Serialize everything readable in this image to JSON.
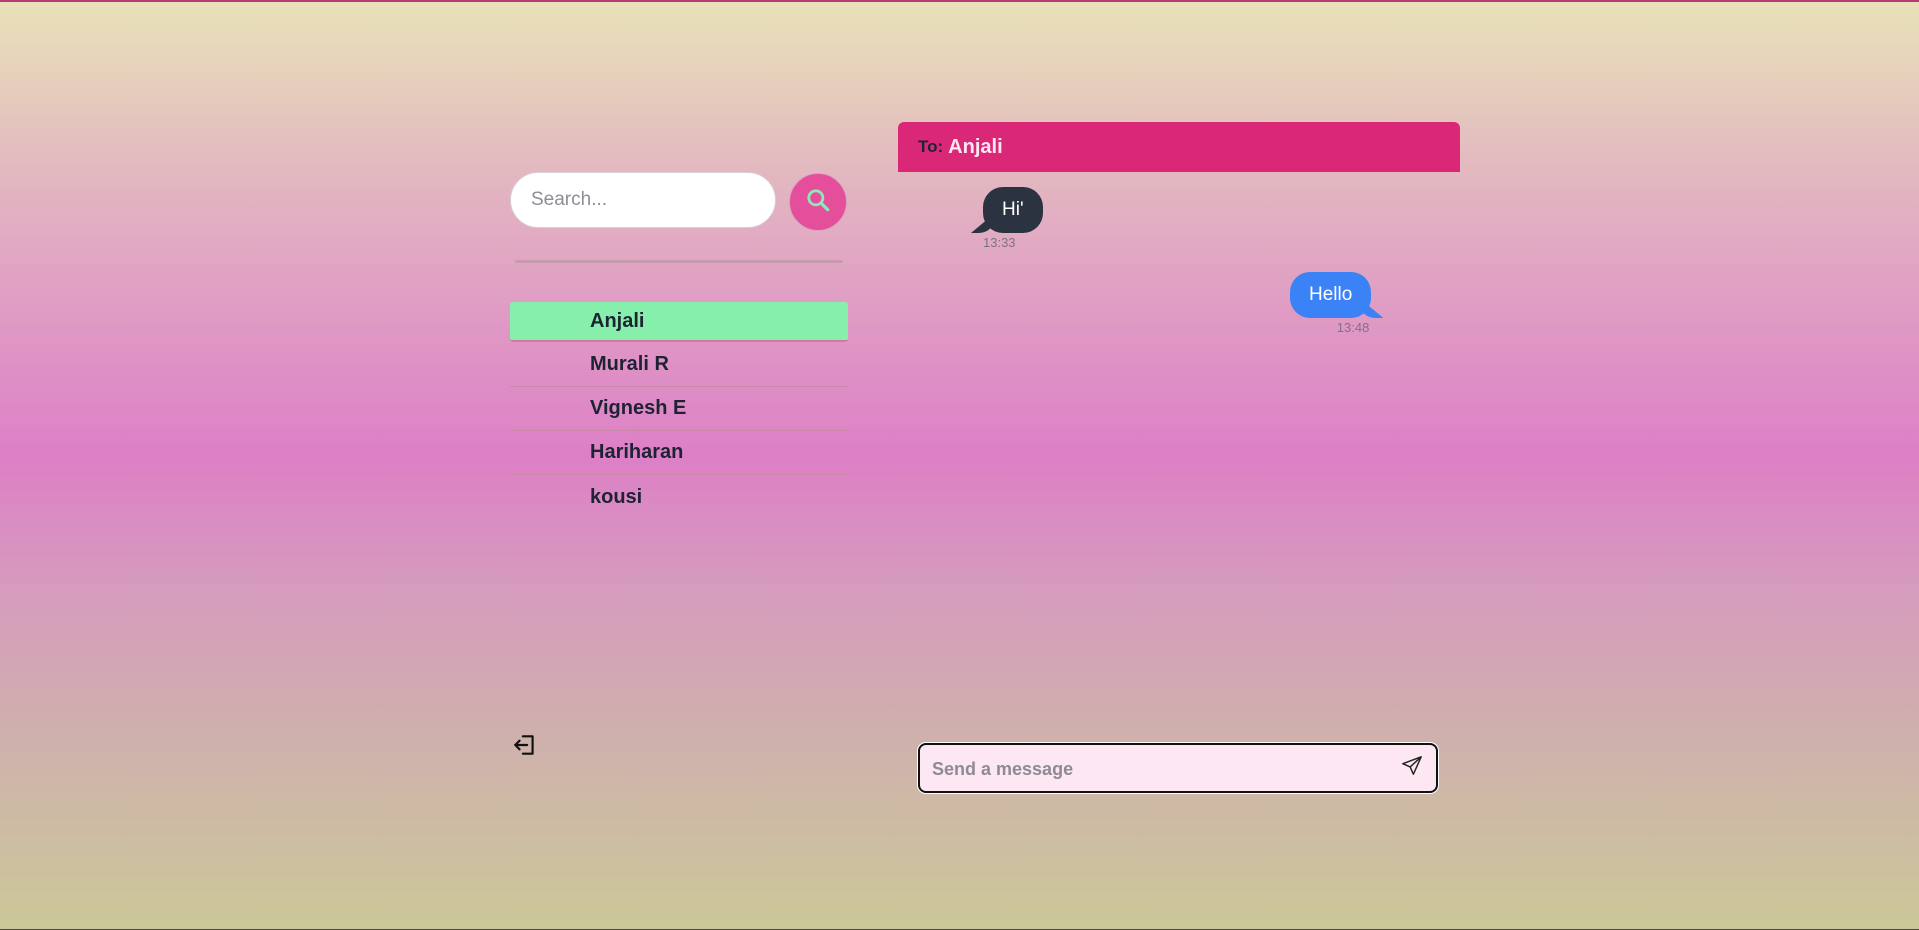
{
  "search": {
    "placeholder": "Search..."
  },
  "contacts": [
    {
      "name": "Anjali",
      "active": true
    },
    {
      "name": "Murali R",
      "active": false
    },
    {
      "name": "Vignesh E",
      "active": false
    },
    {
      "name": "Hariharan",
      "active": false
    },
    {
      "name": "kousi",
      "active": false
    }
  ],
  "chat": {
    "to_label": "To:",
    "recipient": "Anjali",
    "messages": [
      {
        "direction": "incoming",
        "text": "Hi'",
        "time": "13:33"
      },
      {
        "direction": "outgoing",
        "text": "Hello",
        "time": "13:48"
      }
    ],
    "composer_placeholder": "Send a message"
  },
  "icons": {
    "search": "search-icon",
    "logout": "logout-icon",
    "send": "send-icon"
  },
  "colors": {
    "header": "#db2777",
    "active_contact": "#86efac",
    "search_button": "#e54e9a",
    "incoming_bubble": "#2b3240",
    "outgoing_bubble": "#3b82f6",
    "composer_bg": "#fce7f3"
  }
}
